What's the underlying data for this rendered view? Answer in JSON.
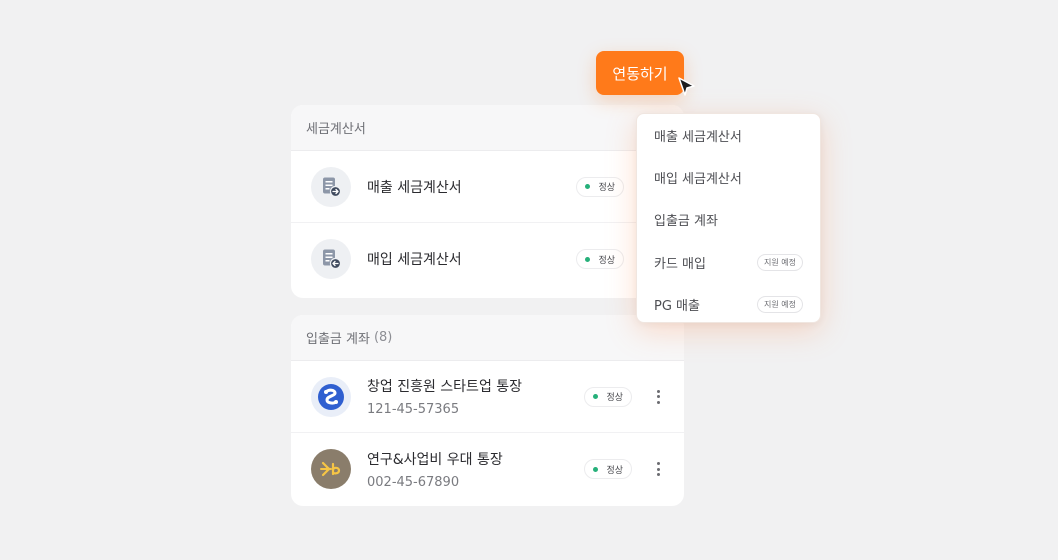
{
  "tax_invoice_card": {
    "title": "세금계산서",
    "rows": [
      {
        "title": "매출 세금계산서",
        "status": "정상",
        "icon": "doc-arrow-right-icon"
      },
      {
        "title": "매입 세금계산서",
        "status": "정상",
        "icon": "doc-arrow-left-icon"
      }
    ]
  },
  "account_card": {
    "title": "입출금 계좌",
    "count": "(8)",
    "rows": [
      {
        "title": "창업 진흥원 스타트업 통장",
        "number": "121-45-57365",
        "status": "정상",
        "icon": "shinhan-bank-logo"
      },
      {
        "title": "연구&사업비 우대 통장",
        "number": "002-45-67890",
        "status": "정상",
        "icon": "kb-bank-logo"
      }
    ]
  },
  "cta_button": {
    "label": "연동하기"
  },
  "dropdown": {
    "items": [
      {
        "label": "매출 세금계산서",
        "tag": ""
      },
      {
        "label": "매입 세금계산서",
        "tag": ""
      },
      {
        "label": "입출금 계좌",
        "tag": ""
      },
      {
        "label": "카드 매입",
        "tag": "지원 예정"
      },
      {
        "label": "PG 매출",
        "tag": "지원 예정"
      }
    ]
  },
  "colors": {
    "accent": "#ff7a1a",
    "status_dot": "#26b07a",
    "background": "#f1f1f2"
  }
}
